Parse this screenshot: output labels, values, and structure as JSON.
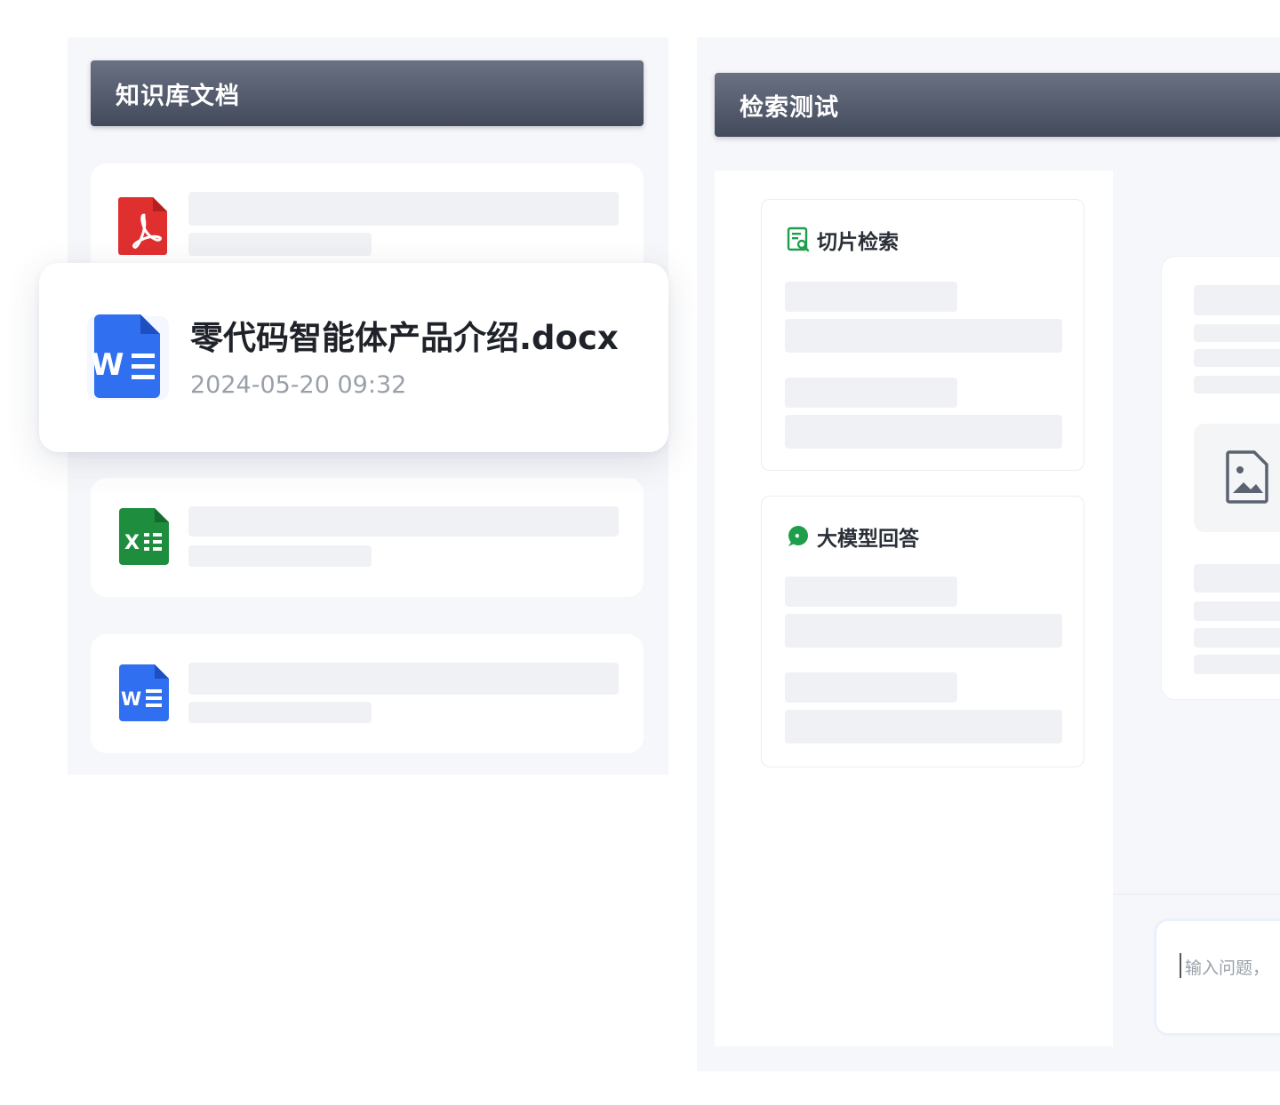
{
  "knowledge_base": {
    "title": "知识库文档",
    "featured_doc": {
      "name": "零代码智能体产品介绍.docx",
      "date": "2024-05-20 09:32"
    },
    "docs": [
      {
        "type": "pdf",
        "icon": "pdf-icon",
        "color": "#e02f2f"
      },
      {
        "type": "docx",
        "icon": "word-icon",
        "color": "#2f6ff0"
      },
      {
        "type": "xlsx",
        "icon": "excel-icon",
        "color": "#1e8e3e"
      },
      {
        "type": "docx",
        "icon": "word-icon",
        "color": "#2f6ff0"
      }
    ]
  },
  "retrieval_test": {
    "title": "检索测试",
    "chunk_search": {
      "title": "切片检索",
      "icon": "document-search-icon"
    },
    "llm_answer": {
      "title": "大模型回答",
      "icon": "chat-bubble-icon"
    },
    "input": {
      "placeholder": "输入问题，"
    }
  },
  "colors": {
    "header_gradient_top": "#6a7183",
    "header_gradient_bottom": "#434a5c",
    "accent_green": "#1e9e4a",
    "skeleton": "#f0f1f4"
  }
}
